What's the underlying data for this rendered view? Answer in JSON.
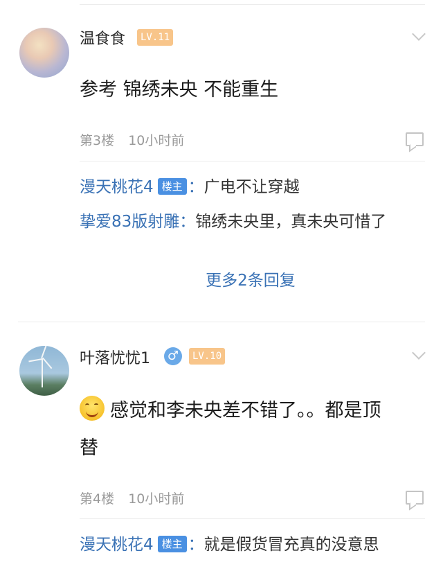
{
  "comments": [
    {
      "username": "温食食",
      "level": "LV.11",
      "content": "参考 锦绣未央 不能重生",
      "floor": "第3楼",
      "time": "10小时前",
      "replies": [
        {
          "user": "漫天桃花4",
          "op_badge": "楼主",
          "separator": "：",
          "text": "广电不让穿越"
        },
        {
          "user": "挚爱83版射雕",
          "separator": "：",
          "text": "锦绣未央里，真未央可惜了"
        }
      ],
      "more_replies": "更多2条回复"
    },
    {
      "username": "叶落忧忧1",
      "gender_icon": "male-icon",
      "gender_symbol": "♂",
      "level": "LV.10",
      "emoji": "smile-emoji",
      "content_line1": "感觉和李未央差不错了。。都是顶",
      "content_line2": "替",
      "floor": "第4楼",
      "time": "10小时前",
      "replies": [
        {
          "user": "漫天桃花4",
          "op_badge": "楼主",
          "separator": "：",
          "text": "就是假货冒充真的没意思"
        }
      ]
    }
  ],
  "colors": {
    "link_blue": "#3a72b5",
    "op_badge": "#4a90e2",
    "level_badge": "#f8c58a",
    "meta_gray": "#9a9a9a"
  }
}
